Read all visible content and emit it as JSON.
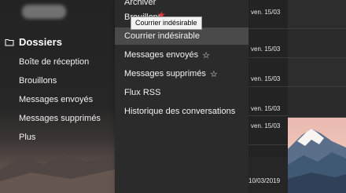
{
  "nav": {
    "section_title": "Dossiers",
    "items": [
      {
        "label": "Boîte de réception"
      },
      {
        "label": "Brouillons"
      },
      {
        "label": "Messages envoyés"
      },
      {
        "label": "Messages supprimés"
      },
      {
        "label": "Plus"
      }
    ]
  },
  "menu": {
    "items": [
      {
        "label": "Archiver",
        "star": ""
      },
      {
        "label": "Brouillons",
        "star": ""
      },
      {
        "label": "Courrier indésirable",
        "star": ""
      },
      {
        "label": "Messages envoyés",
        "star": "☆"
      },
      {
        "label": "Messages supprimés",
        "star": "☆"
      },
      {
        "label": "Flux RSS",
        "star": ""
      },
      {
        "label": "Historique des conversations",
        "star": ""
      }
    ],
    "active_index": 2,
    "tooltip": "Courrier indésirable"
  },
  "list": {
    "dates": [
      "ven. 15/03",
      "ven. 15/03",
      "ven. 15/03",
      "ven. 15/03",
      "ven. 15/03"
    ],
    "footer_date": "10/03/2019"
  },
  "colors": {
    "background": "#1f1f1f",
    "menu_background": "#2b2b2b",
    "menu_active": "#4a4a4a",
    "tooltip_background": "#f2f2f2",
    "star_red": "#e23a3a"
  },
  "icons": {
    "folder": "folder-icon",
    "star_outline": "star-outline-icon",
    "star_pin": "star-pin-icon"
  }
}
